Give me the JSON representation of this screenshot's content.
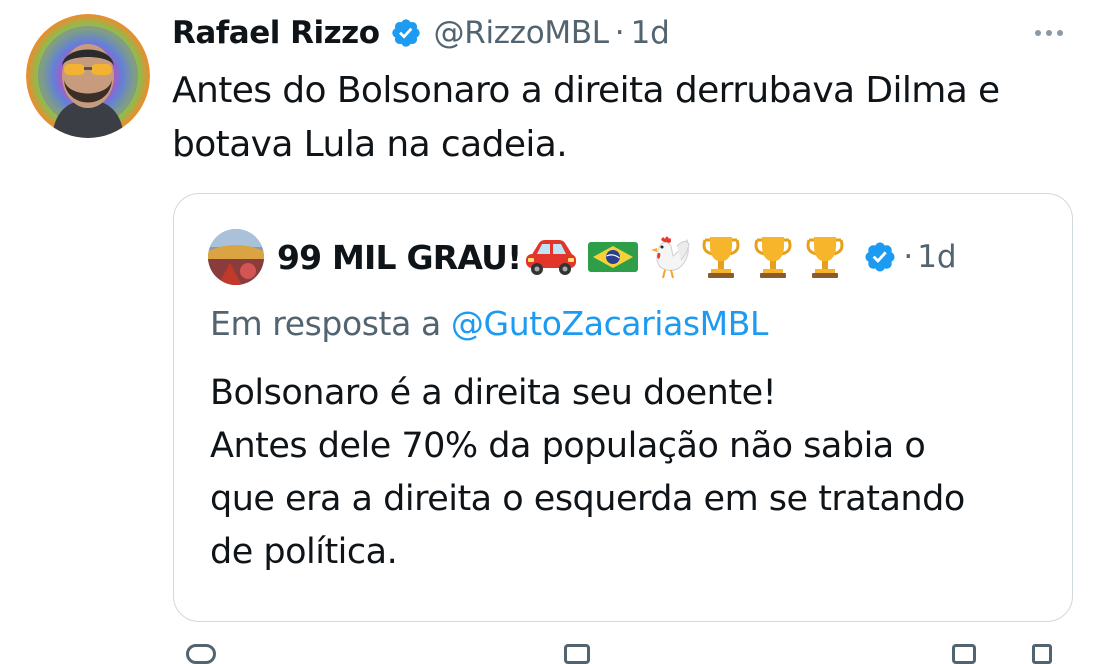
{
  "tweet": {
    "author_name": "Rafael Rizzo",
    "handle": "@RizzoMBL",
    "separator": "·",
    "time": "1d",
    "text": "Antes do Bolsonaro a direita derrubava Dilma e botava Lula na cadeia."
  },
  "quote": {
    "author_name": "99 MIL GRAU!",
    "name_emojis": [
      "car-emoji",
      "brazil-flag-emoji",
      "rooster-emoji",
      "trophy-emoji",
      "trophy-emoji",
      "trophy-emoji"
    ],
    "separator": "·",
    "time": "1d",
    "reply_prefix": "Em resposta a",
    "reply_mention": "@GutoZacariasMBL",
    "text_lines": [
      "Bolsonaro é a direita seu doente!",
      "Antes dele 70% da população não sabia o",
      "que era a direita o esquerda em se tratando",
      "de política."
    ]
  },
  "colors": {
    "text": "#0f1419",
    "secondary": "#536471",
    "link": "#1d9bf0",
    "verified": "#1d9bf0",
    "border": "#cfd9de"
  }
}
